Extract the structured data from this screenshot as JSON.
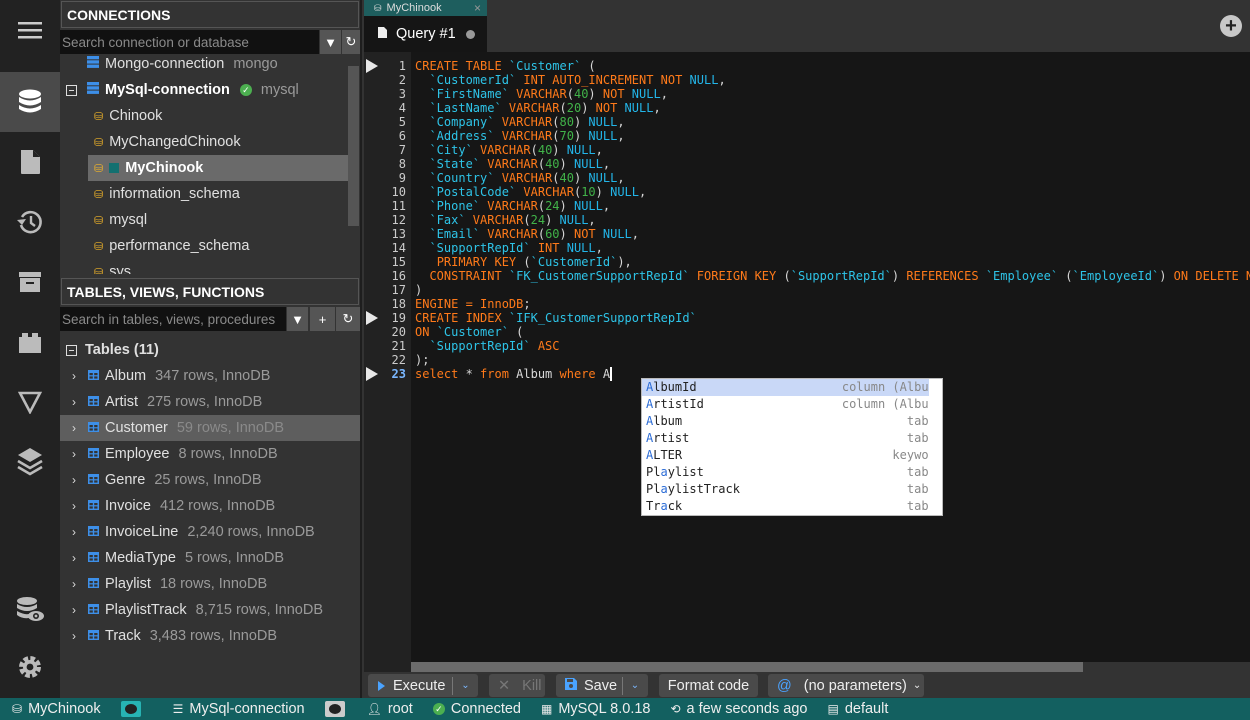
{
  "sidebar_icons": [
    {
      "name": "menu-icon"
    },
    {
      "name": "database-icon",
      "active": true
    },
    {
      "name": "file-icon"
    },
    {
      "name": "history-icon"
    },
    {
      "name": "archive-icon"
    },
    {
      "name": "plugin-icon"
    },
    {
      "name": "filter-icon"
    },
    {
      "name": "layers-icon"
    },
    {
      "name": "database-eye-icon"
    },
    {
      "name": "gear-icon"
    }
  ],
  "connections": {
    "title": "CONNECTIONS",
    "search_placeholder": "Search connection or database",
    "items": [
      {
        "label": "Mongo-connection",
        "sub": "mongo",
        "type": "server"
      },
      {
        "label": "MySql-connection",
        "sub": "mysql",
        "type": "server",
        "expanded": true,
        "connected": true
      },
      {
        "label": "Chinook",
        "type": "db"
      },
      {
        "label": "MyChangedChinook",
        "type": "db"
      },
      {
        "label": "MyChinook",
        "type": "db",
        "selected": true
      },
      {
        "label": "information_schema",
        "type": "db"
      },
      {
        "label": "mysql",
        "type": "db"
      },
      {
        "label": "performance_schema",
        "type": "db"
      },
      {
        "label": "sys",
        "type": "db"
      }
    ]
  },
  "objects": {
    "title": "TABLES, VIEWS, FUNCTIONS",
    "search_placeholder": "Search in tables, views, procedures",
    "group_label": "Tables (11)",
    "tables": [
      {
        "name": "Album",
        "info": "347 rows, InnoDB"
      },
      {
        "name": "Artist",
        "info": "275 rows, InnoDB"
      },
      {
        "name": "Customer",
        "info": "59 rows, InnoDB",
        "selected": true
      },
      {
        "name": "Employee",
        "info": "8 rows, InnoDB"
      },
      {
        "name": "Genre",
        "info": "25 rows, InnoDB"
      },
      {
        "name": "Invoice",
        "info": "412 rows, InnoDB"
      },
      {
        "name": "InvoiceLine",
        "info": "2,240 rows, InnoDB"
      },
      {
        "name": "MediaType",
        "info": "5 rows, InnoDB"
      },
      {
        "name": "Playlist",
        "info": "18 rows, InnoDB"
      },
      {
        "name": "PlaylistTrack",
        "info": "8,715 rows, InnoDB"
      },
      {
        "name": "Track",
        "info": "3,483 rows, InnoDB"
      }
    ]
  },
  "tabs": {
    "connection_tab": "MyChinook",
    "query_tab": "Query #1"
  },
  "editor": {
    "run_markers": [
      1,
      19,
      23
    ],
    "current_line": 23,
    "lines": [
      [
        [
          "k",
          "CREATE TABLE "
        ],
        [
          "i",
          "`Customer`"
        ],
        [
          "w",
          " ("
        ]
      ],
      [
        [
          "w",
          "  "
        ],
        [
          "i",
          "`CustomerId`"
        ],
        [
          "k",
          " INT AUTO_INCREMENT NOT "
        ],
        [
          "u",
          "NULL"
        ],
        [
          "w",
          ","
        ]
      ],
      [
        [
          "w",
          "  "
        ],
        [
          "i",
          "`FirstName`"
        ],
        [
          "k",
          " VARCHAR"
        ],
        [
          "w",
          "("
        ],
        [
          "n",
          "40"
        ],
        [
          "w",
          ")"
        ],
        [
          "k",
          " NOT "
        ],
        [
          "u",
          "NULL"
        ],
        [
          "w",
          ","
        ]
      ],
      [
        [
          "w",
          "  "
        ],
        [
          "i",
          "`LastName`"
        ],
        [
          "k",
          " VARCHAR"
        ],
        [
          "w",
          "("
        ],
        [
          "n",
          "20"
        ],
        [
          "w",
          ")"
        ],
        [
          "k",
          " NOT "
        ],
        [
          "u",
          "NULL"
        ],
        [
          "w",
          ","
        ]
      ],
      [
        [
          "w",
          "  "
        ],
        [
          "i",
          "`Company`"
        ],
        [
          "k",
          " VARCHAR"
        ],
        [
          "w",
          "("
        ],
        [
          "n",
          "80"
        ],
        [
          "w",
          ") "
        ],
        [
          "u",
          "NULL"
        ],
        [
          "w",
          ","
        ]
      ],
      [
        [
          "w",
          "  "
        ],
        [
          "i",
          "`Address`"
        ],
        [
          "k",
          " VARCHAR"
        ],
        [
          "w",
          "("
        ],
        [
          "n",
          "70"
        ],
        [
          "w",
          ") "
        ],
        [
          "u",
          "NULL"
        ],
        [
          "w",
          ","
        ]
      ],
      [
        [
          "w",
          "  "
        ],
        [
          "i",
          "`City`"
        ],
        [
          "k",
          " VARCHAR"
        ],
        [
          "w",
          "("
        ],
        [
          "n",
          "40"
        ],
        [
          "w",
          ") "
        ],
        [
          "u",
          "NULL"
        ],
        [
          "w",
          ","
        ]
      ],
      [
        [
          "w",
          "  "
        ],
        [
          "i",
          "`State`"
        ],
        [
          "k",
          " VARCHAR"
        ],
        [
          "w",
          "("
        ],
        [
          "n",
          "40"
        ],
        [
          "w",
          ") "
        ],
        [
          "u",
          "NULL"
        ],
        [
          "w",
          ","
        ]
      ],
      [
        [
          "w",
          "  "
        ],
        [
          "i",
          "`Country`"
        ],
        [
          "k",
          " VARCHAR"
        ],
        [
          "w",
          "("
        ],
        [
          "n",
          "40"
        ],
        [
          "w",
          ") "
        ],
        [
          "u",
          "NULL"
        ],
        [
          "w",
          ","
        ]
      ],
      [
        [
          "w",
          "  "
        ],
        [
          "i",
          "`PostalCode`"
        ],
        [
          "k",
          " VARCHAR"
        ],
        [
          "w",
          "("
        ],
        [
          "n",
          "10"
        ],
        [
          "w",
          ") "
        ],
        [
          "u",
          "NULL"
        ],
        [
          "w",
          ","
        ]
      ],
      [
        [
          "w",
          "  "
        ],
        [
          "i",
          "`Phone`"
        ],
        [
          "k",
          " VARCHAR"
        ],
        [
          "w",
          "("
        ],
        [
          "n",
          "24"
        ],
        [
          "w",
          ") "
        ],
        [
          "u",
          "NULL"
        ],
        [
          "w",
          ","
        ]
      ],
      [
        [
          "w",
          "  "
        ],
        [
          "i",
          "`Fax`"
        ],
        [
          "k",
          " VARCHAR"
        ],
        [
          "w",
          "("
        ],
        [
          "n",
          "24"
        ],
        [
          "w",
          ") "
        ],
        [
          "u",
          "NULL"
        ],
        [
          "w",
          ","
        ]
      ],
      [
        [
          "w",
          "  "
        ],
        [
          "i",
          "`Email`"
        ],
        [
          "k",
          " VARCHAR"
        ],
        [
          "w",
          "("
        ],
        [
          "n",
          "60"
        ],
        [
          "w",
          ")"
        ],
        [
          "k",
          " NOT "
        ],
        [
          "u",
          "NULL"
        ],
        [
          "w",
          ","
        ]
      ],
      [
        [
          "w",
          "  "
        ],
        [
          "i",
          "`SupportRepId`"
        ],
        [
          "k",
          " INT "
        ],
        [
          "u",
          "NULL"
        ],
        [
          "w",
          ","
        ]
      ],
      [
        [
          "w",
          "   "
        ],
        [
          "k",
          "PRIMARY KEY "
        ],
        [
          "w",
          "("
        ],
        [
          "i",
          "`CustomerId`"
        ],
        [
          "w",
          "),"
        ]
      ],
      [
        [
          "w",
          "  "
        ],
        [
          "k",
          "CONSTRAINT "
        ],
        [
          "i",
          "`FK_CustomerSupportRepId`"
        ],
        [
          "k",
          " FOREIGN KEY "
        ],
        [
          "w",
          "("
        ],
        [
          "i",
          "`SupportRepId`"
        ],
        [
          "w",
          ")"
        ],
        [
          "k",
          " REFERENCES "
        ],
        [
          "i",
          "`Employee`"
        ],
        [
          "w",
          " ("
        ],
        [
          "i",
          "`EmployeeId`"
        ],
        [
          "w",
          ")"
        ],
        [
          "k",
          " ON DELETE NO ACTION"
        ]
      ],
      [
        [
          "w",
          ")"
        ]
      ],
      [
        [
          "k",
          "ENGINE = InnoDB"
        ],
        [
          "w",
          ";"
        ]
      ],
      [
        [
          "k",
          "CREATE INDEX "
        ],
        [
          "i",
          "`IFK_CustomerSupportRepId`"
        ]
      ],
      [
        [
          "k",
          "ON "
        ],
        [
          "i",
          "`Customer`"
        ],
        [
          "w",
          " ("
        ]
      ],
      [
        [
          "w",
          "  "
        ],
        [
          "i",
          "`SupportRepId`"
        ],
        [
          "k",
          " ASC"
        ]
      ],
      [
        [
          "w",
          ");"
        ]
      ],
      [
        [
          "k",
          "select "
        ],
        [
          "w",
          "* "
        ],
        [
          "k",
          "from "
        ],
        [
          "w",
          "Album "
        ],
        [
          "k",
          "where "
        ],
        [
          "w",
          "A"
        ]
      ]
    ]
  },
  "autocomplete": {
    "items": [
      {
        "pre": "",
        "hl": "A",
        "post": "lbumId",
        "type": "column (Album)",
        "selected": true
      },
      {
        "pre": "",
        "hl": "A",
        "post": "rtistId",
        "type": "column (Album)"
      },
      {
        "pre": "",
        "hl": "A",
        "post": "lbum",
        "type": "table"
      },
      {
        "pre": "",
        "hl": "A",
        "post": "rtist",
        "type": "table"
      },
      {
        "pre": "",
        "hl": "A",
        "post": "LTER",
        "type": "keyword"
      },
      {
        "pre": "Pl",
        "hl": "a",
        "post": "ylist",
        "type": "table"
      },
      {
        "pre": "Pl",
        "hl": "a",
        "post": "ylistTrack",
        "type": "table"
      },
      {
        "pre": "Tr",
        "hl": "a",
        "post": "ck",
        "type": "table"
      }
    ]
  },
  "toolbar": {
    "execute_label": "Execute",
    "kill_label": "Kill",
    "save_label": "Save",
    "format_label": "Format code",
    "params_label": "(no parameters)"
  },
  "statusbar": {
    "database": "MyChinook",
    "connection": "MySql-connection",
    "user": "root",
    "status": "Connected",
    "server_version": "MySQL 8.0.18",
    "last_refresh": "a few seconds ago",
    "schema": "default"
  },
  "colors": {
    "accent": "#136060",
    "keyword": "#ff7a1a",
    "identifier": "#2ec4e8",
    "number": "#41b349",
    "connected": "#4caf50"
  }
}
